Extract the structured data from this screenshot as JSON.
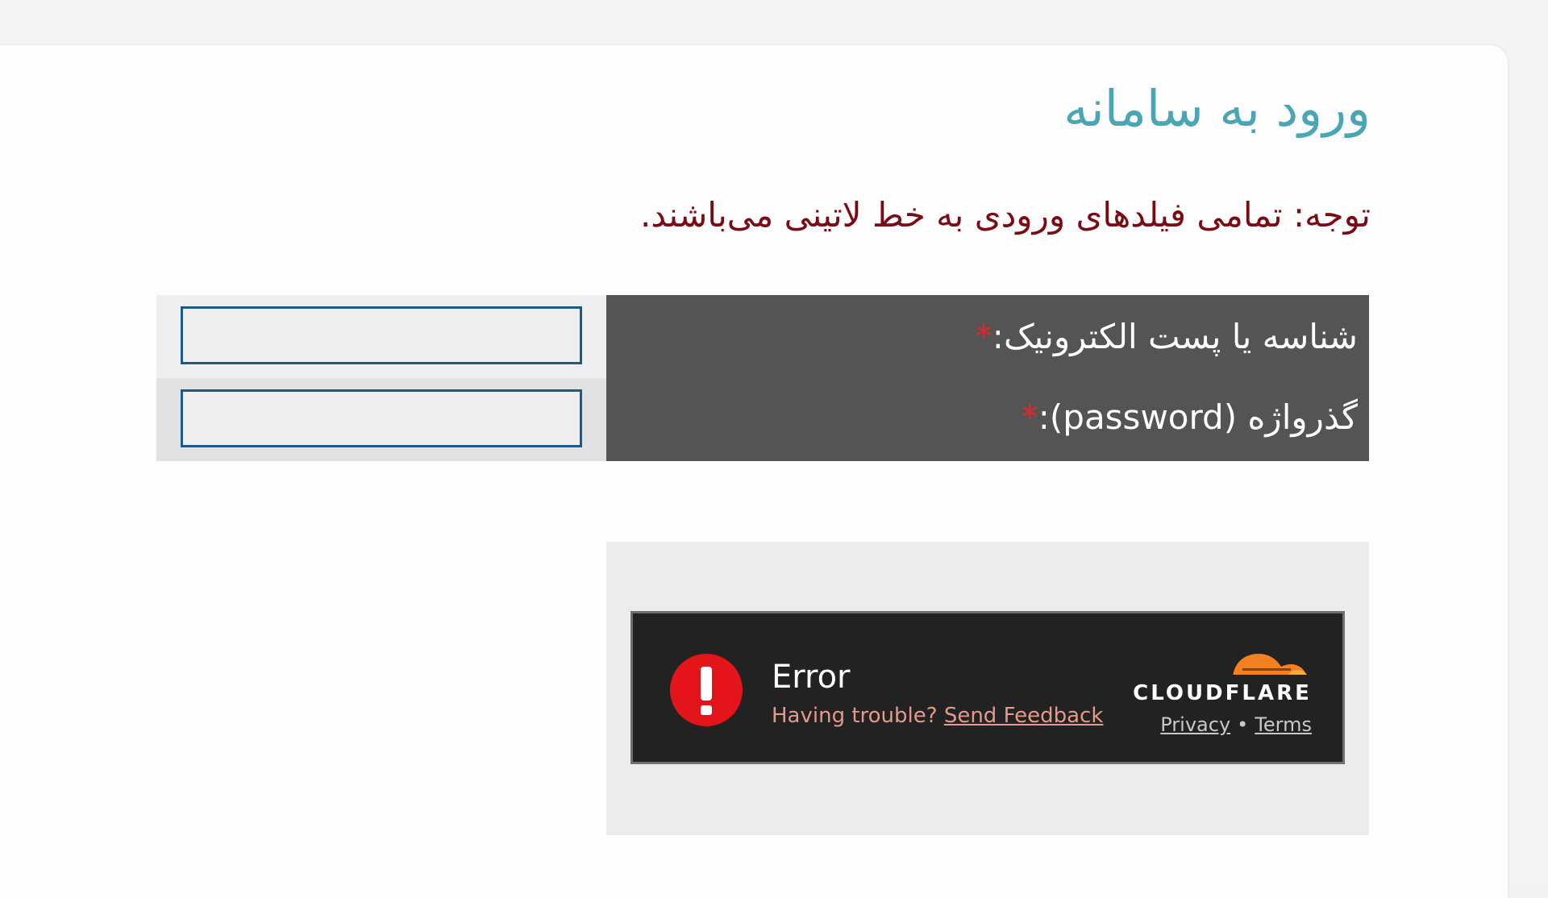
{
  "page": {
    "title": "ورود به سامانه",
    "notice": "توجه: تمامی فیلدهای ورودی به خط لاتینی می‌باشند."
  },
  "form": {
    "username_label": "شناسه یا پست الکترونیک:",
    "password_label": "گذرواژه (password):",
    "required_marker": "*",
    "username_value": "",
    "password_value": ""
  },
  "captcha": {
    "status": "Error",
    "trouble_text": "Having trouble?",
    "feedback_link": "Send Feedback",
    "brand": "CLOUDFLARE",
    "privacy_link": "Privacy",
    "separator": "•",
    "terms_link": "Terms"
  },
  "colors": {
    "title": "#4aa6b3",
    "notice": "#7a0a14",
    "label_bg": "#545454",
    "required": "#e0262d",
    "error_icon": "#e4141b",
    "cloudflare_orange": "#f48120"
  }
}
